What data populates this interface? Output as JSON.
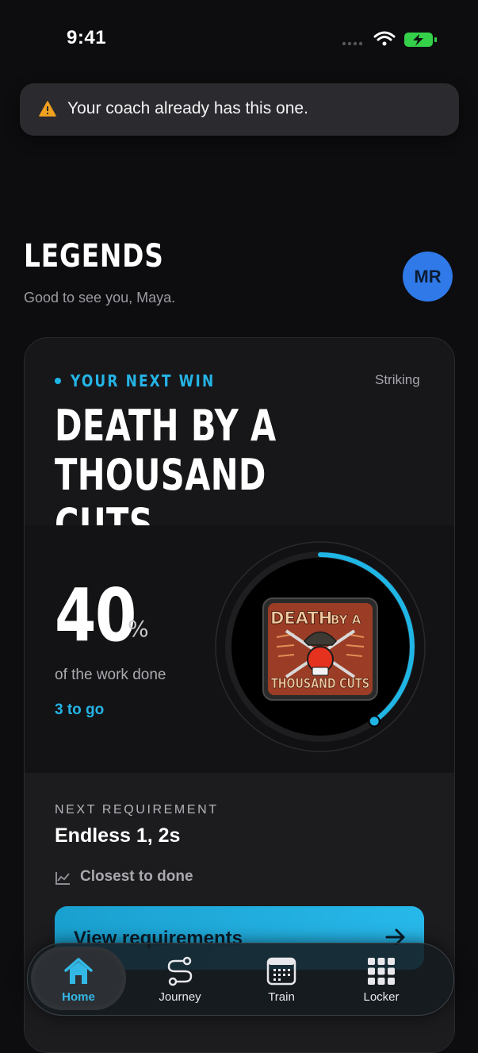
{
  "status_bar": {
    "time": "9:41"
  },
  "toast": {
    "icon": "warning-icon",
    "message": "Your coach already has this one."
  },
  "header": {
    "title": "LEGENDS",
    "greeting": "Good to see you, Maya.",
    "avatar_initials": "MR"
  },
  "next_win": {
    "kicker": "YOUR NEXT WIN",
    "category": "Striking",
    "title_line1": "DEATH BY A",
    "title_line2": "THOUSAND CUTS",
    "progress_value": "40",
    "progress_unit": "%",
    "progress_fraction": 0.4,
    "progress_caption": "of the work done",
    "remaining": "3 to go",
    "badge": {
      "line1": "DEATH",
      "line1b": "BY A",
      "line2": "THOUSAND CUTS"
    },
    "requirement_label": "NEXT REQUIREMENT",
    "requirement_value": "Endless 1, 2s",
    "closest_label": "Closest to done",
    "button_label": "View requirements"
  },
  "tabs": [
    {
      "label": "Home",
      "icon": "home-icon",
      "active": true
    },
    {
      "label": "Journey",
      "icon": "route-icon",
      "active": false
    },
    {
      "label": "Train",
      "icon": "calendar-icon",
      "active": false
    },
    {
      "label": "Locker",
      "icon": "grid-icon",
      "active": false
    }
  ],
  "colors": {
    "accent": "#25b4e6",
    "background": "#0d0d0f",
    "avatar": "#2f79e8",
    "battery": "#35d04a",
    "warning": "#f0a11f"
  }
}
